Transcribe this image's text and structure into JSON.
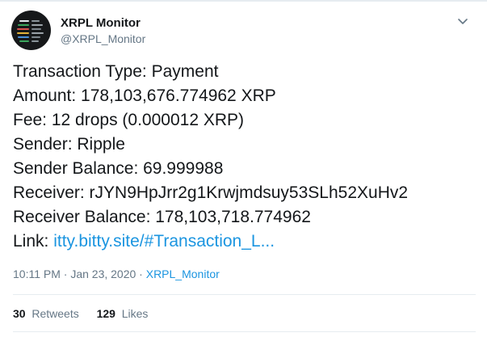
{
  "header": {
    "display_name": "XRPL Monitor",
    "handle": "@XRPL_Monitor"
  },
  "body": {
    "lines": {
      "tx_type": "Transaction Type: Payment",
      "amount": "Amount: 178,103,676.774962 XRP",
      "fee": "Fee: 12 drops (0.000012 XRP)",
      "sender": "Sender: Ripple",
      "sender_balance": "Sender Balance: 69.999988",
      "receiver": "Receiver: rJYN9HpJrr2g1Krwjmdsuy53SLh52XuHv2",
      "receiver_balance": "Receiver Balance: 178,103,718.774962"
    },
    "link_label": "Link: ",
    "link_text": "itty.bitty.site/#Transaction_L..."
  },
  "meta": {
    "timestamp": "10:11 PM · Jan 23, 2020 · ",
    "source": "XRPL_Monitor"
  },
  "stats": {
    "retweets_count": "30",
    "retweets_label": "Retweets",
    "likes_count": "129",
    "likes_label": "Likes"
  },
  "icons": {
    "menu": "chevron-down-icon",
    "avatar": "monitor-dashboard-avatar"
  },
  "colors": {
    "text": "#14171a",
    "secondary": "#657786",
    "link": "#1b95e0",
    "divider": "#e6ecf0"
  }
}
